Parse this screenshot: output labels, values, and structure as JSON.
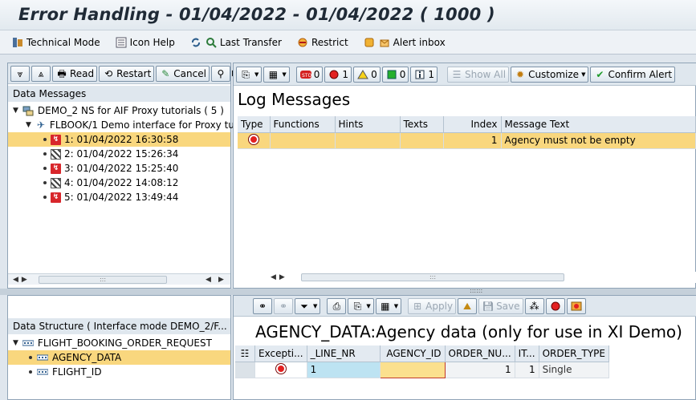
{
  "window": {
    "title": "Error Handling - 01/04/2022 - 01/04/2022 ( 1000 )"
  },
  "appbar": {
    "items": [
      {
        "label": "Technical Mode",
        "icon": "technical-mode-icon"
      },
      {
        "label": "Icon Help",
        "icon": "icon-help-icon"
      },
      {
        "label": "Last Transfer",
        "icon": "last-transfer-icon"
      },
      {
        "label": "Restrict",
        "icon": "restrict-icon"
      },
      {
        "label": "Alert inbox",
        "icon": "alert-inbox-icon"
      }
    ]
  },
  "left_top": {
    "toolbar": {
      "read": "Read",
      "restart": "Restart",
      "cancel": "Cancel"
    },
    "section_title": "Data Messages",
    "root": {
      "label": "DEMO_2 NS for AIF Proxy tutorials ( 5  )"
    },
    "interface": {
      "label": "FLBOOK/1 Demo interface for Proxy tu"
    },
    "messages": [
      {
        "label": "1: 01/04/2022 16:30:58",
        "status": "error"
      },
      {
        "label": "2: 01/04/2022 15:26:34",
        "status": "done"
      },
      {
        "label": "3: 01/04/2022 15:25:40",
        "status": "error"
      },
      {
        "label": "4: 01/04/2022 14:08:12",
        "status": "done"
      },
      {
        "label": "5: 01/04/2022 13:49:44",
        "status": "error"
      }
    ],
    "scroll_mid": ":::"
  },
  "log": {
    "toolbar": {
      "stop_count": "0",
      "error_count": "1",
      "warning_count": "0",
      "success_count": "0",
      "info_count": "1",
      "show_all": "Show All",
      "customize": "Customize",
      "confirm_alert": "Confirm Alert"
    },
    "title": "Log Messages",
    "columns": [
      "Type",
      "Functions",
      "Hints",
      "Texts",
      "Index",
      "Message Text"
    ],
    "rows": [
      {
        "type": "error",
        "functions": "",
        "hints": "",
        "texts": "",
        "index": "1",
        "message": "Agency must not be empty"
      }
    ],
    "scroll_mid": ":::",
    "splitter": "::::::"
  },
  "left_bottom": {
    "section_title": "Data Structure ( Interface mode DEMO_2/F...",
    "root": {
      "label": "FLIGHT_BOOKING_ORDER_REQUEST"
    },
    "children": [
      {
        "label": "AGENCY_DATA"
      },
      {
        "label": "FLIGHT_ID"
      }
    ]
  },
  "structure": {
    "toolbar": {
      "apply": "Apply",
      "save": "Save"
    },
    "title": "AGENCY_DATA:Agency data (only for use in XI Demo)",
    "columns": [
      "Excepti...",
      "_LINE_NR",
      "AGENCY_ID",
      "ORDER_NU...",
      "IT...",
      "ORDER_TYPE"
    ],
    "rows": [
      {
        "exception": "error",
        "line_nr": "1",
        "agency_id": "",
        "order_nu": "1",
        "it": "1",
        "order_type": "Single"
      }
    ]
  }
}
